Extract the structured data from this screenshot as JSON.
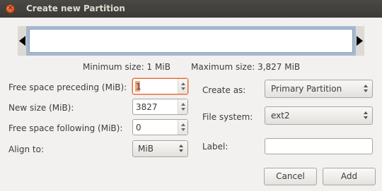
{
  "window": {
    "title": "Create new Partition"
  },
  "graph": {
    "min_size": "Minimum size: 1 MiB",
    "max_size": "Maximum size: 3,827 MiB"
  },
  "fields": {
    "free_preceding": {
      "label": "Free space preceding (MiB):",
      "value": "1"
    },
    "new_size": {
      "label": "New size (MiB):",
      "value": "3827"
    },
    "free_following": {
      "label": "Free space following (MiB):",
      "value": "0"
    },
    "align": {
      "label": "Align to:",
      "value": "MiB"
    },
    "create_as": {
      "label": "Create as:",
      "value": "Primary Partition"
    },
    "file_system": {
      "label": "File system:",
      "value": "ext2"
    },
    "partition_label": {
      "label": "Label:",
      "value": ""
    }
  },
  "buttons": {
    "cancel": "Cancel",
    "add": "Add"
  },
  "colors": {
    "focus_border": "#e06a3b",
    "partition_track": "#a7b9cf",
    "close_button": "#e0501e"
  }
}
